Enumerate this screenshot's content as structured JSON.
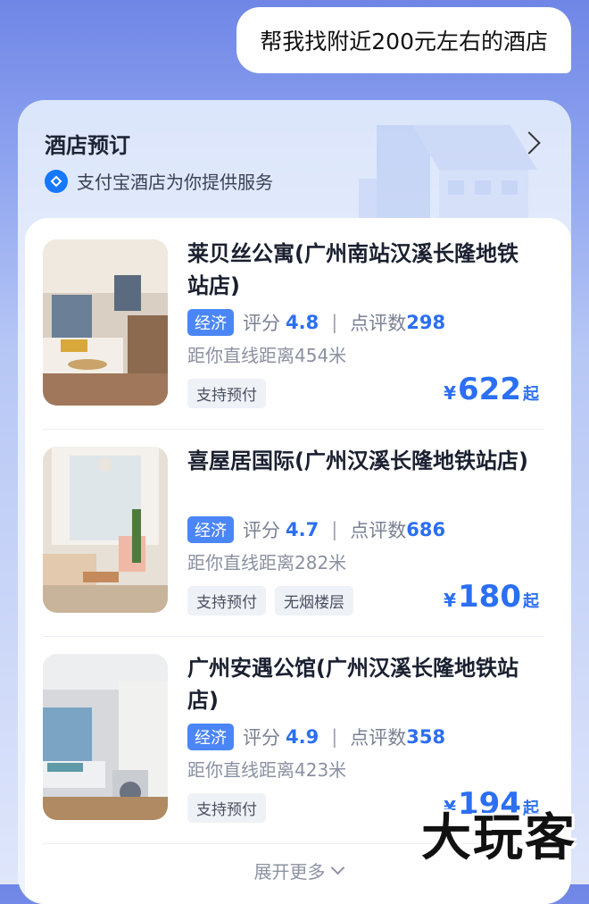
{
  "chat": {
    "user_message": "帮我找附近200元左右的酒店"
  },
  "card": {
    "title": "酒店预订",
    "provider": "支付宝酒店为你提供服务",
    "expand_label": "展开更多"
  },
  "hotels": [
    {
      "name": "莱贝丝公寓(广州南站汉溪长隆地铁站店)",
      "level": "经济",
      "rating_label": "评分",
      "rating": "4.8",
      "reviews_label": "点评数",
      "reviews": "298",
      "distance": "距你直线距离454米",
      "tags": [
        "支持预付"
      ],
      "price_currency": "¥",
      "price": "622",
      "price_suffix": "起"
    },
    {
      "name": "喜屋居国际(广州汉溪长隆地铁站店)",
      "level": "经济",
      "rating_label": "评分",
      "rating": "4.7",
      "reviews_label": "点评数",
      "reviews": "686",
      "distance": "距你直线距离282米",
      "tags": [
        "支持预付",
        "无烟楼层"
      ],
      "price_currency": "¥",
      "price": "180",
      "price_suffix": "起"
    },
    {
      "name": "广州安遇公馆(广州汉溪长隆地铁站店)",
      "level": "经济",
      "rating_label": "评分",
      "rating": "4.9",
      "reviews_label": "点评数",
      "reviews": "358",
      "distance": "距你直线距离423米",
      "tags": [
        "支持预付"
      ],
      "price_currency": "¥",
      "price": "194",
      "price_suffix": "起"
    }
  ],
  "watermark": "大玩客",
  "colors": {
    "accent": "#2b6ff2",
    "tag_eco": "#4b86f6"
  }
}
